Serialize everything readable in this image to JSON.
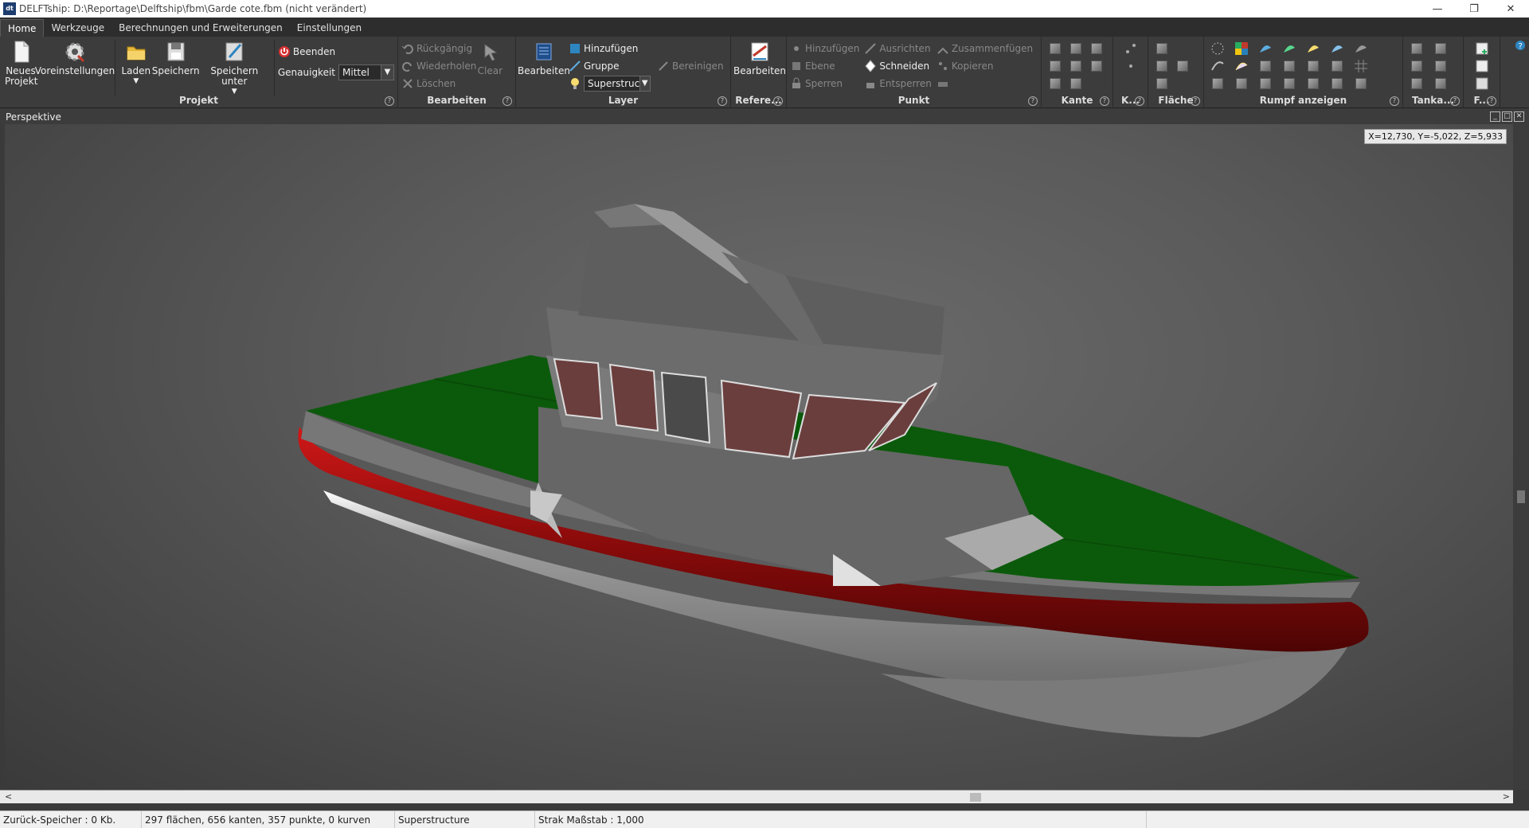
{
  "window": {
    "title": "DELFTship: D:\\Reportage\\Delftship\\fbm\\Garde cote.fbm (nicht verändert)",
    "icon": "dt-logo-icon"
  },
  "menu": {
    "tabs": [
      "Home",
      "Werkzeuge",
      "Berechnungen und Erweiterungen",
      "Einstellungen"
    ],
    "active": "Home"
  },
  "ribbon": {
    "projekt": {
      "label": "Projekt",
      "neues_projekt": "Neues Projekt",
      "voreinstellungen": "Voreinstellungen",
      "laden": "Laden",
      "speichern": "Speichern",
      "speichern_unter": "Speichern unter",
      "beenden": "Beenden",
      "genauigkeit_label": "Genauigkeit",
      "genauigkeit_value": "Mittel"
    },
    "bearbeiten": {
      "label": "Bearbeiten",
      "rueckgaengig": "Rückgängig",
      "wiederholen": "Wiederholen",
      "loeschen": "Löschen",
      "clear": "Clear"
    },
    "layer": {
      "label": "Layer",
      "bearbeiten": "Bearbeiten",
      "hinzufuegen": "Hinzufügen",
      "gruppe": "Gruppe",
      "current_layer": "Superstructu",
      "bereinigen": "Bereinigen"
    },
    "referenz": {
      "label": "Refere...",
      "bearbeiten": "Bearbeiten"
    },
    "punkt": {
      "label": "Punkt",
      "hinzufuegen": "Hinzufügen",
      "ebene": "Ebene",
      "sperren": "Sperren",
      "ausrichten": "Ausrichten",
      "schneiden": "Schneiden",
      "entsperren": "Entsperren",
      "zusammenfuegen": "Zusammenfügen",
      "kopieren": "Kopieren"
    },
    "kante": {
      "label": "Kante"
    },
    "k": {
      "label": "K..."
    },
    "flaeche": {
      "label": "Fläche"
    },
    "rumpf": {
      "label": "Rumpf anzeigen"
    },
    "tanka": {
      "label": "Tanka..."
    },
    "f": {
      "label": "F..."
    }
  },
  "viewport": {
    "title": "Perspektive",
    "coords": "X=12,730, Y=-5,022, Z=5,933"
  },
  "status": {
    "zurueck": "Zurück-Speicher : 0 Kb.",
    "counts": "297 flächen, 656 kanten, 357 punkte, 0 kurven",
    "layer": "Superstructure",
    "strak": "Strak Maßstab : 1,000"
  },
  "colors": {
    "deck": "#0b5a0b",
    "hull_red": "#8c0b0b",
    "hull_gray": "#6d6d6d",
    "glass": "#6b3e3e"
  }
}
